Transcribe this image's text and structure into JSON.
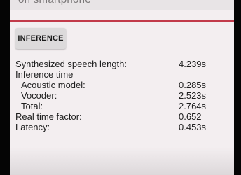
{
  "header": {
    "cut_off_text": "on smartphone"
  },
  "inference_button": {
    "label": "INFERENCE"
  },
  "metrics": {
    "synthesized_length": {
      "label": "Synthesized speech length:",
      "value": "4.239s"
    },
    "inference_time": {
      "label": "Inference time"
    },
    "acoustic_model": {
      "label": "Acoustic model:",
      "value": "0.285s"
    },
    "vocoder": {
      "label": "Vocoder:",
      "value": "2.523s"
    },
    "total": {
      "label": "Total:",
      "value": "2.764s"
    },
    "real_time_factor": {
      "label": "Real time factor:",
      "value": "0.652"
    },
    "latency": {
      "label": "Latency:",
      "value": "0.453s"
    }
  },
  "colors": {
    "accent_divider": "#c23a4a",
    "screen_background": "#f3eef0",
    "button_background": "#dcdadb"
  }
}
